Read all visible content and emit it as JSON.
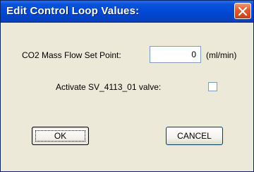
{
  "dialog": {
    "title": "Edit Control Loop Values:",
    "close_icon": "close-x-icon",
    "title_color": "#0047d6",
    "close_color": "#e0582a"
  },
  "form": {
    "flow_label": "CO2 Mass Flow Set Point:",
    "flow_value": "0",
    "flow_unit": "(ml/min)",
    "valve_label": "Activate SV_4113_01 valve:",
    "valve_checked": false
  },
  "buttons": {
    "ok_label": "OK",
    "cancel_label": "CANCEL"
  }
}
